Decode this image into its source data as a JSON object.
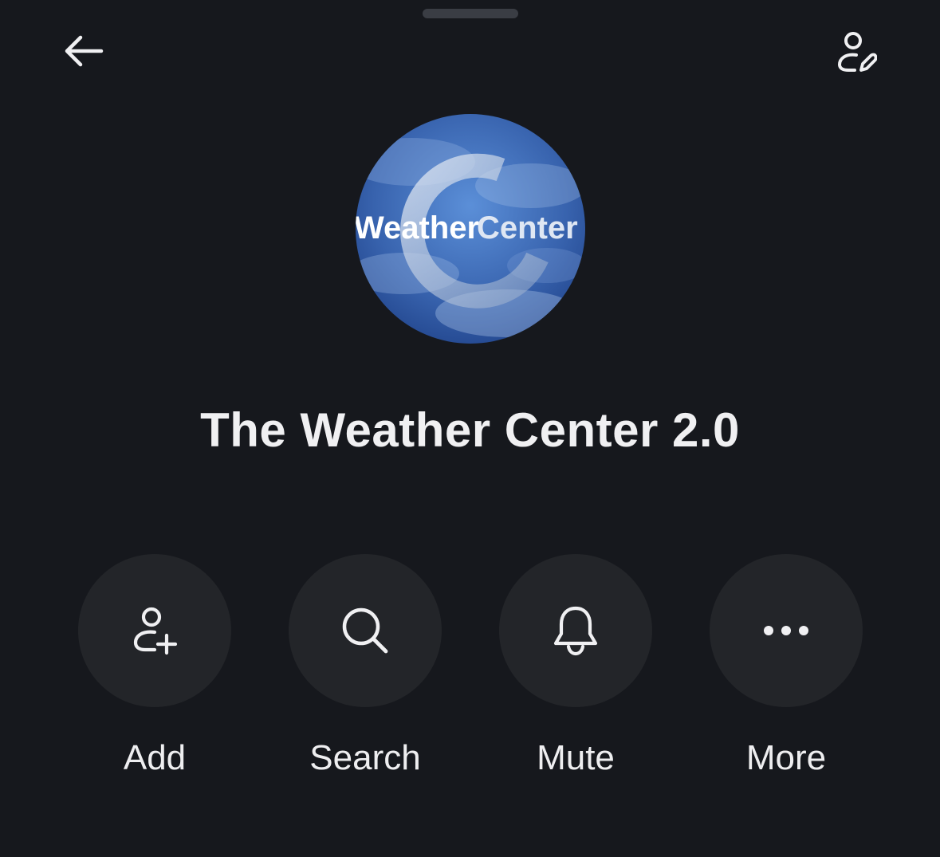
{
  "header": {
    "back_icon": "arrow-left-icon",
    "edit_icon": "person-edit-icon"
  },
  "avatar": {
    "logo_text_left": "Weather",
    "logo_text_right": "Center",
    "background": "#3d6cb8"
  },
  "group": {
    "name": "The Weather Center 2.0"
  },
  "actions": [
    {
      "label": "Add",
      "icon": "person-add-icon"
    },
    {
      "label": "Search",
      "icon": "search-icon"
    },
    {
      "label": "Mute",
      "icon": "bell-icon"
    },
    {
      "label": "More",
      "icon": "more-dots-icon"
    }
  ],
  "colors": {
    "background": "#16181d",
    "button": "#232529",
    "text": "#f0f0f2"
  }
}
